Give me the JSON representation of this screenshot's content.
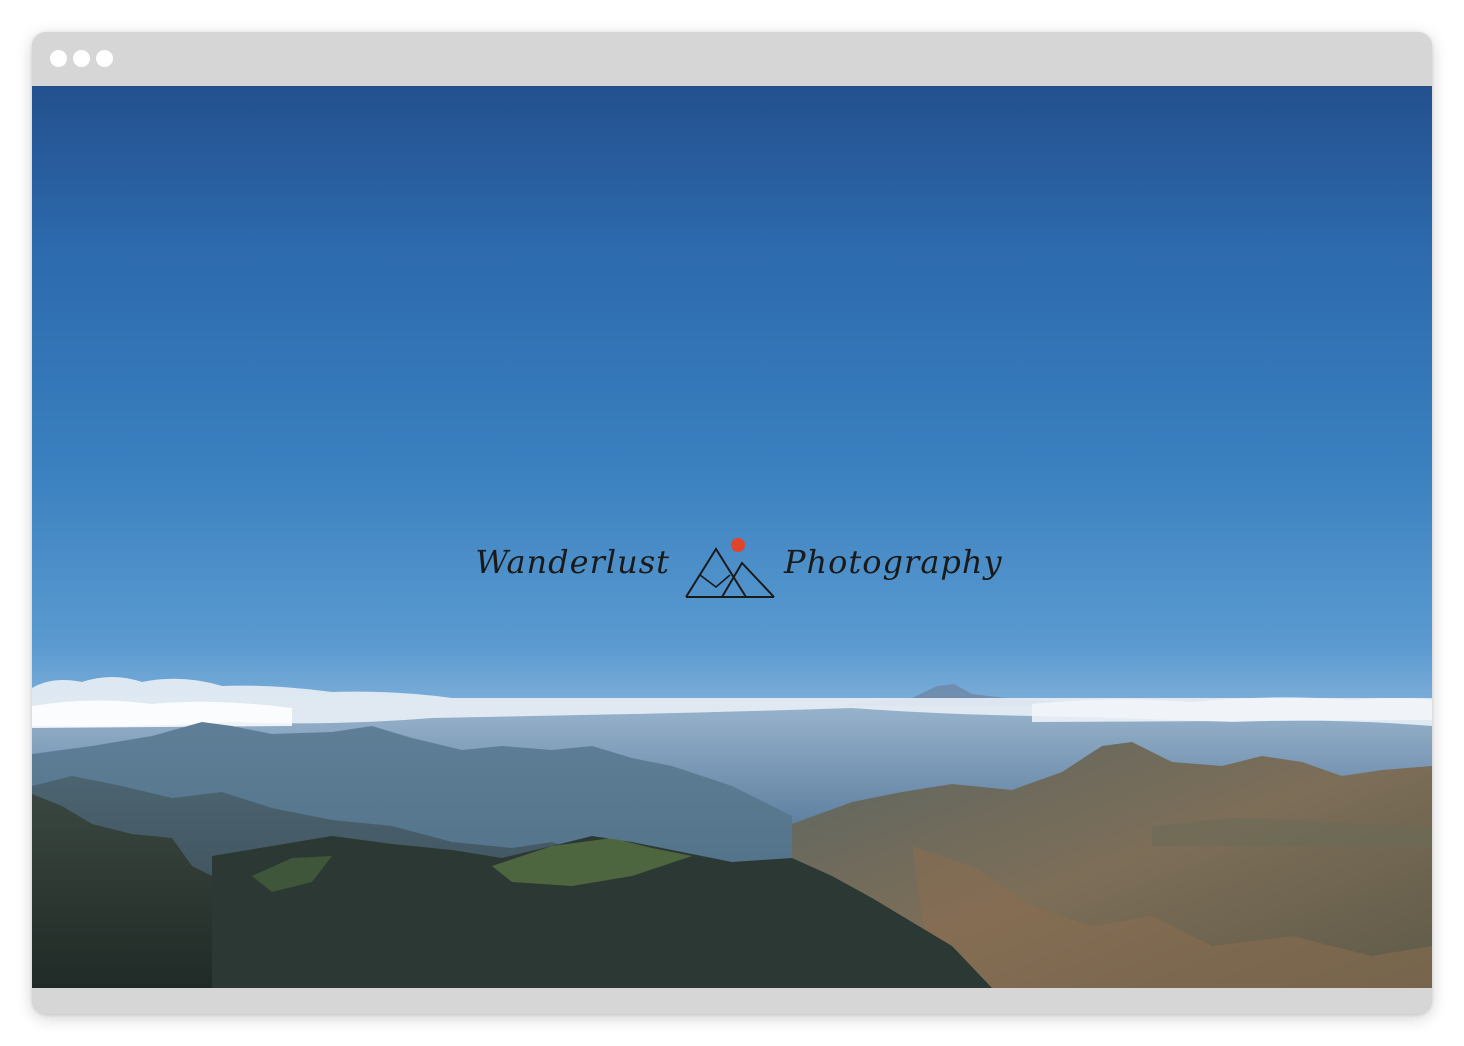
{
  "window": {
    "controls": [
      "dot-1",
      "dot-2",
      "dot-3"
    ]
  },
  "brand": {
    "name_left": "Wanderlust",
    "name_right": "Photography",
    "mark_icon": "mountain-sun-icon",
    "sun_color": "#e0452b",
    "ink_color": "#1a1a1a"
  }
}
